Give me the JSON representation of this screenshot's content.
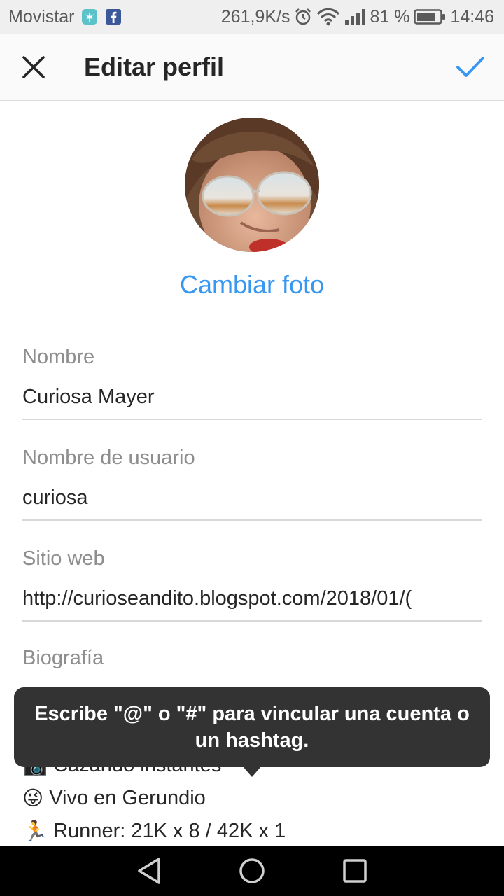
{
  "status_bar": {
    "carrier": "Movistar",
    "speed": "261,9K/s",
    "battery": "81 %",
    "battery_level": 0.81,
    "time": "14:46",
    "icons": [
      "weed-icon",
      "facebook-icon",
      "alarm-icon",
      "wifi-icon",
      "signal-icon",
      "battery-icon"
    ]
  },
  "app_bar": {
    "title": "Editar perfil",
    "close_icon": "close-icon",
    "done_icon": "check-icon",
    "accent": "#3897f0"
  },
  "profile": {
    "change_photo": "Cambiar foto"
  },
  "fields": {
    "name": {
      "label": "Nombre",
      "value": "Curiosa Mayer"
    },
    "username": {
      "label": "Nombre de usuario",
      "value": "curiosa"
    },
    "website": {
      "label": "Sitio web",
      "value": "http://curioseandito.blogspot.com/2018/01/("
    },
    "bio": {
      "label": "Biografía",
      "lines": [
        {
          "emoji": "📷",
          "text": "Cazando instantes"
        },
        {
          "emoji": "😜",
          "text": "Vivo en Gerundio"
        },
        {
          "emoji": "🏃",
          "text": "Runner: 21K x 8 / 42K x 1"
        }
      ]
    }
  },
  "tooltip": {
    "text": "Escribe \"@\" o \"#\" para vincular una cuenta o un hashtag."
  },
  "nav_bar": {
    "icons": [
      "back-triangle-icon",
      "home-circle-icon",
      "recents-square-icon"
    ]
  }
}
